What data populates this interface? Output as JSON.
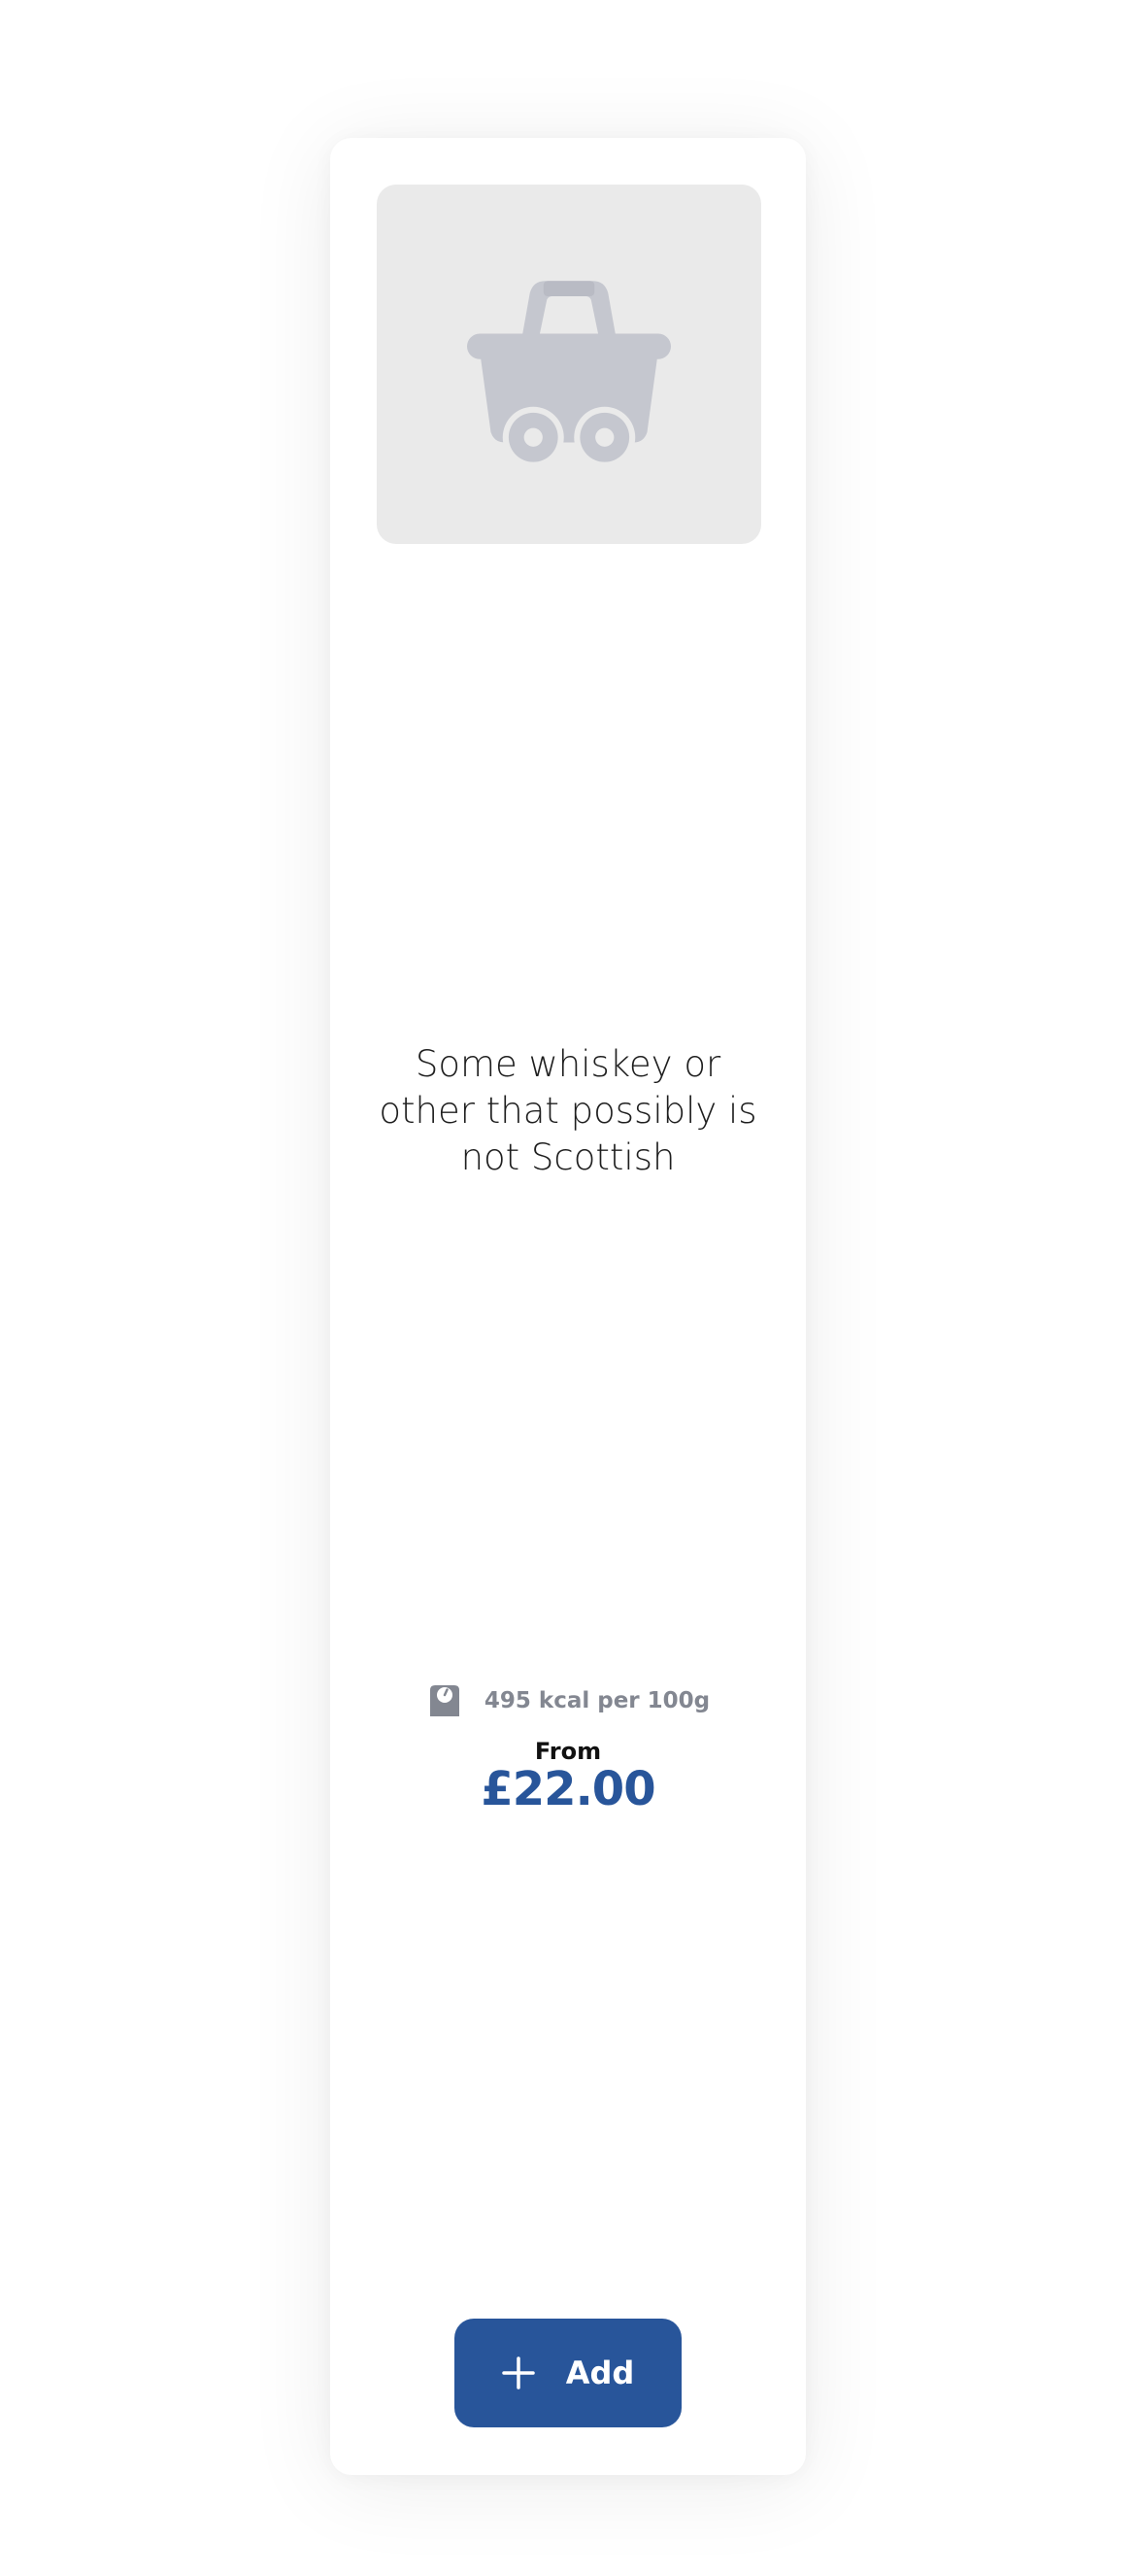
{
  "product": {
    "title": "Some whiskey or other that possibly is not Scottish",
    "image_icon": "basket-icon",
    "nutrition": {
      "icon": "scale-icon",
      "text": "495 kcal per 100g"
    },
    "price_prefix": "From",
    "price": "£22.00"
  },
  "actions": {
    "add_icon": "plus-icon",
    "add_label": "Add"
  },
  "colors": {
    "accent": "#28559a",
    "placeholder_bg": "#eaeaea",
    "placeholder_icon": "#c5c7cf",
    "muted_text": "#838791"
  }
}
